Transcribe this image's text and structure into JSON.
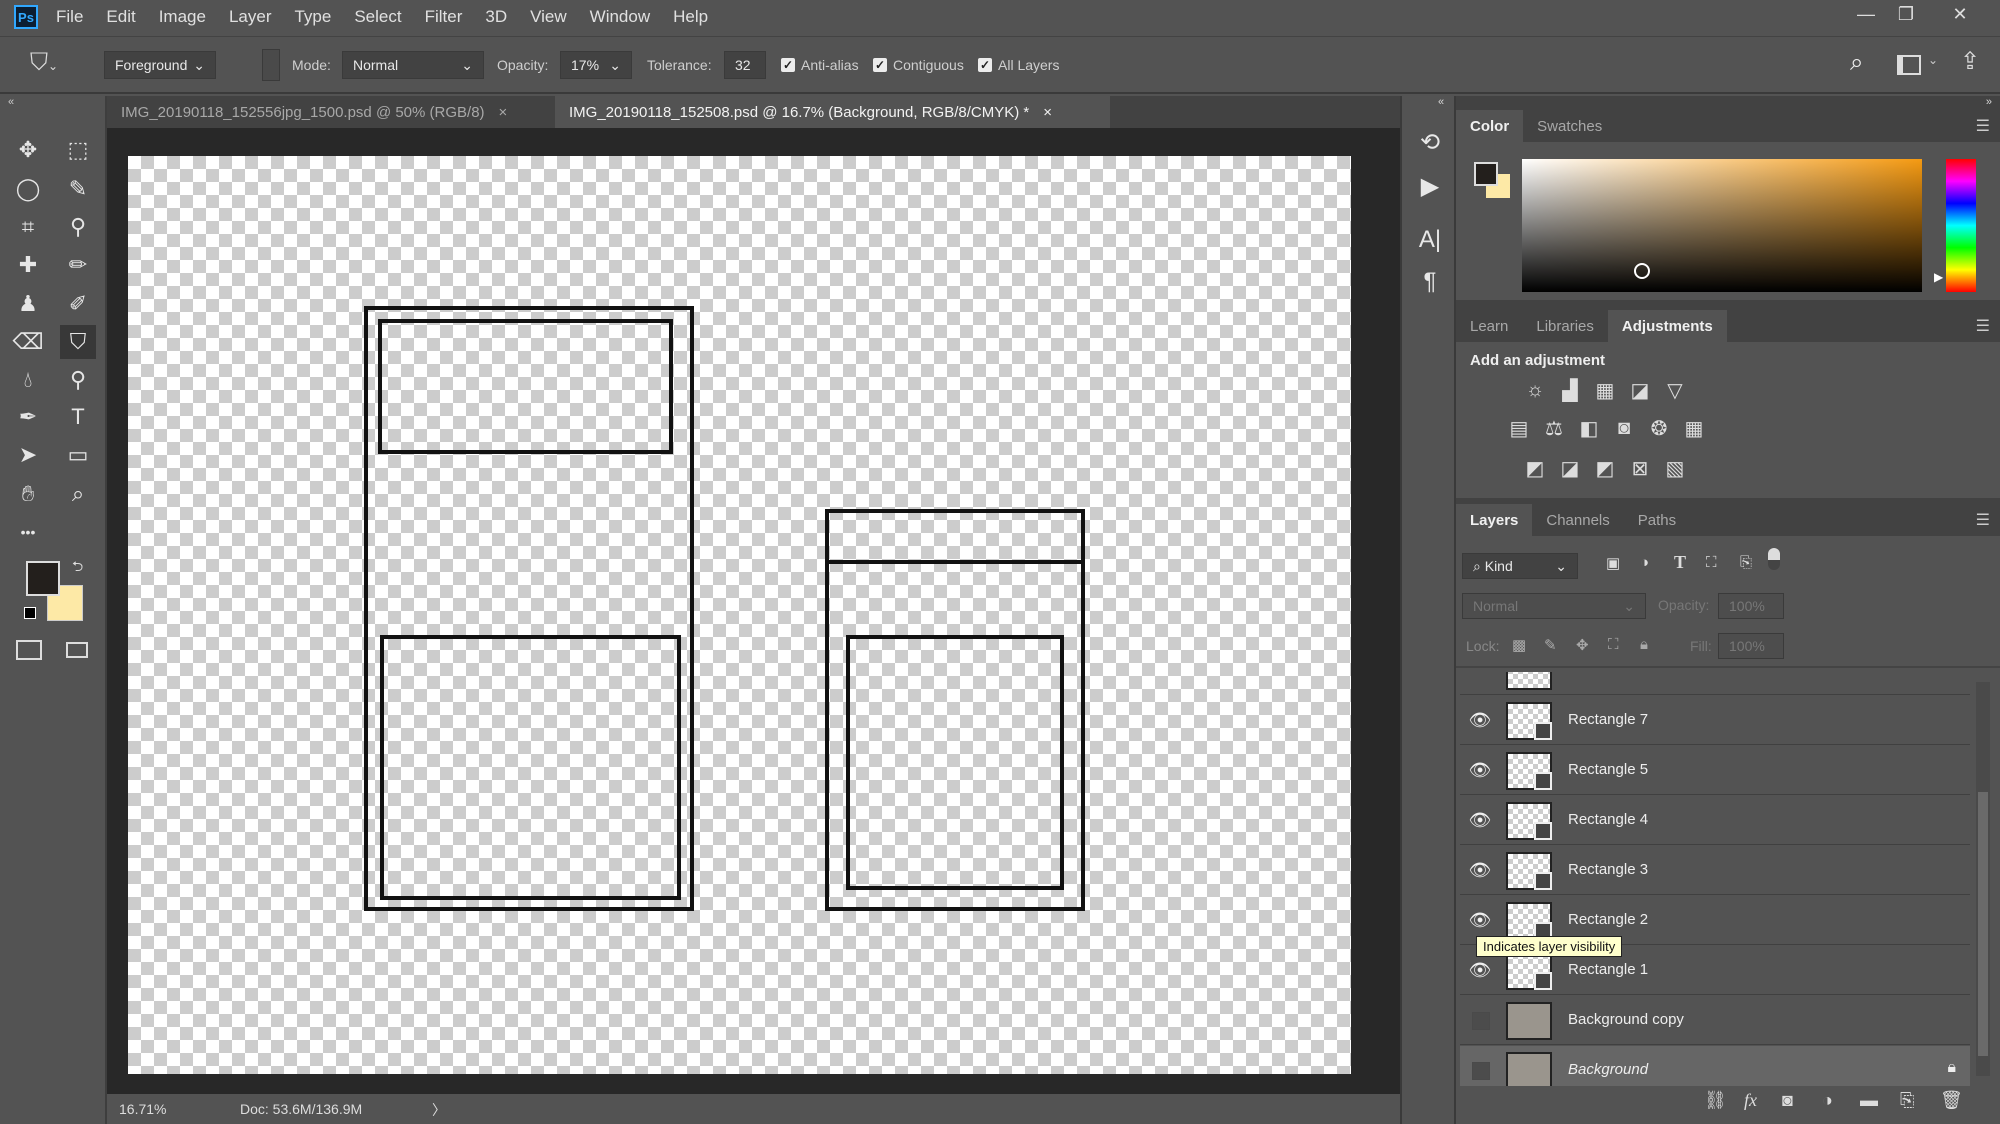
{
  "app": {
    "logo": "Ps",
    "menu": [
      "File",
      "Edit",
      "Image",
      "Layer",
      "Type",
      "Select",
      "Filter",
      "3D",
      "View",
      "Window",
      "Help"
    ],
    "window_controls": {
      "minimize": "—",
      "restore": "❐",
      "close": "✕"
    }
  },
  "options": {
    "tool_icon": "paint-bucket-icon",
    "fill_source": "Foreground",
    "mode_label": "Mode:",
    "mode": "Normal",
    "opacity_label": "Opacity:",
    "opacity": "17%",
    "tolerance_label": "Tolerance:",
    "tolerance": "32",
    "anti_alias": {
      "label": "Anti-alias",
      "checked": true
    },
    "contiguous": {
      "label": "Contiguous",
      "checked": true
    },
    "all_layers": {
      "label": "All Layers",
      "checked": true
    }
  },
  "tabs": [
    {
      "label": "IMG_20190118_152556jpg_1500.psd @ 50% (RGB/8)",
      "active": false
    },
    {
      "label": "IMG_20190118_152508.psd @ 16.7% (Background, RGB/8/CMYK) *",
      "active": true
    }
  ],
  "tools": [
    "move",
    "rectangular-marquee",
    "lasso",
    "quick-selection",
    "crop",
    "eyedropper",
    "healing-brush",
    "brush",
    "clone-stamp",
    "history-brush",
    "eraser",
    "paint-bucket",
    "blur",
    "dodge",
    "pen",
    "type",
    "path-selection",
    "rectangle",
    "rotate-view",
    "zoom",
    "more"
  ],
  "colors": {
    "foreground": "#231f1c",
    "background": "#fde9a6",
    "hue_accent": "#f59a12"
  },
  "status": {
    "zoom": "16.71%",
    "doc": "Doc: 53.6M/136.9M",
    "arrow": "〉"
  },
  "color_panel": {
    "tabs": [
      "Color",
      "Swatches"
    ],
    "active": "Color"
  },
  "adjust_panel": {
    "tabs": [
      "Learn",
      "Libraries",
      "Adjustments"
    ],
    "active": "Adjustments",
    "heading": "Add an adjustment"
  },
  "layers_panel": {
    "tabs": [
      "Layers",
      "Channels",
      "Paths"
    ],
    "active": "Layers",
    "filter": "Kind",
    "blend": "Normal",
    "opacity_label": "Opacity:",
    "opacity": "100%",
    "lock_label": "Lock:",
    "fill_label": "Fill:",
    "fill": "100%",
    "layers": [
      {
        "name": "Rectangle 7",
        "visible": true
      },
      {
        "name": "Rectangle 5",
        "visible": true
      },
      {
        "name": "Rectangle 4",
        "visible": true
      },
      {
        "name": "Rectangle 3",
        "visible": true
      },
      {
        "name": "Rectangle 2",
        "visible": true
      },
      {
        "name": "Rectangle 1",
        "visible": true
      },
      {
        "name": "Background copy",
        "visible": false
      },
      {
        "name": "Background",
        "visible": false,
        "locked": true,
        "selected": true
      }
    ],
    "tooltip": "Indicates layer visibility"
  }
}
